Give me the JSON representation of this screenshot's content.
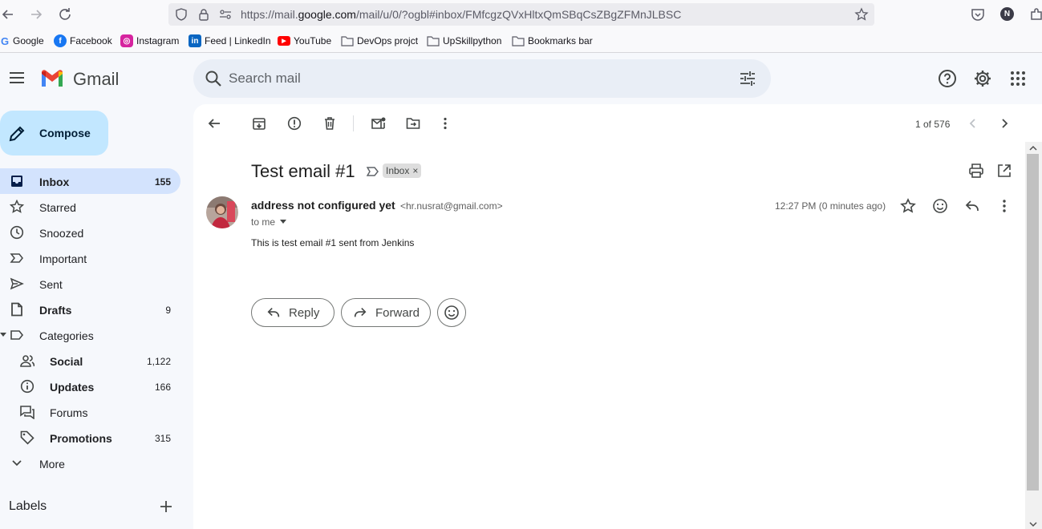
{
  "browser": {
    "url_prefix": "https://mail.",
    "url_host": "google.com",
    "url_rest": "/mail/u/0/?ogbl#inbox/FMfcgzQVxHltxQmSBqCsZBgZFMnJLBSC",
    "profile_initial": "N",
    "bookmarks": [
      {
        "label": "Google",
        "icon": "google-icon"
      },
      {
        "label": "Facebook",
        "icon": "facebook-icon"
      },
      {
        "label": "Instagram",
        "icon": "instagram-icon"
      },
      {
        "label": "Feed | LinkedIn",
        "icon": "linkedin-icon"
      },
      {
        "label": "YouTube",
        "icon": "youtube-icon"
      },
      {
        "label": "DevOps projct",
        "icon": "folder-icon"
      },
      {
        "label": "UpSkillpython",
        "icon": "folder-icon"
      },
      {
        "label": "Bookmarks bar",
        "icon": "folder-icon"
      }
    ]
  },
  "header": {
    "app_name": "Gmail",
    "search_placeholder": "Search mail"
  },
  "sidebar": {
    "compose_label": "Compose",
    "items": [
      {
        "label": "Inbox",
        "count": "155",
        "icon": "inbox-icon",
        "bold": true,
        "active": true
      },
      {
        "label": "Starred",
        "count": "",
        "icon": "star-icon"
      },
      {
        "label": "Snoozed",
        "count": "",
        "icon": "clock-icon"
      },
      {
        "label": "Important",
        "count": "",
        "icon": "important-icon"
      },
      {
        "label": "Sent",
        "count": "",
        "icon": "send-icon"
      },
      {
        "label": "Drafts",
        "count": "9",
        "icon": "draft-icon",
        "bold": true
      },
      {
        "label": "Categories",
        "count": "",
        "icon": "label-icon"
      },
      {
        "label": "Social",
        "count": "1,122",
        "icon": "people-icon",
        "bold": true
      },
      {
        "label": "Updates",
        "count": "166",
        "icon": "info-icon",
        "bold": true
      },
      {
        "label": "Forums",
        "count": "",
        "icon": "forum-icon"
      },
      {
        "label": "Promotions",
        "count": "315",
        "icon": "tag-icon",
        "bold": true
      },
      {
        "label": "More",
        "count": "",
        "icon": "chevron-down-icon"
      }
    ],
    "labels_heading": "Labels"
  },
  "toolbar": {
    "pager_text": "1 of 576"
  },
  "message": {
    "subject": "Test email #1",
    "label_chip": "Inbox",
    "sender_name": "address not configured yet",
    "sender_email": "<hr.nusrat@gmail.com>",
    "recipient": "to me",
    "timestamp": "12:27 PM (0 minutes ago)",
    "body": "This is test email #1 sent from Jenkins",
    "reply_label": "Reply",
    "forward_label": "Forward"
  },
  "colors": {
    "active_nav": "#d3e3fd",
    "compose_bg": "#c2e7ff",
    "search_bg": "#e9eef6",
    "app_bg": "#f6f8fc"
  }
}
